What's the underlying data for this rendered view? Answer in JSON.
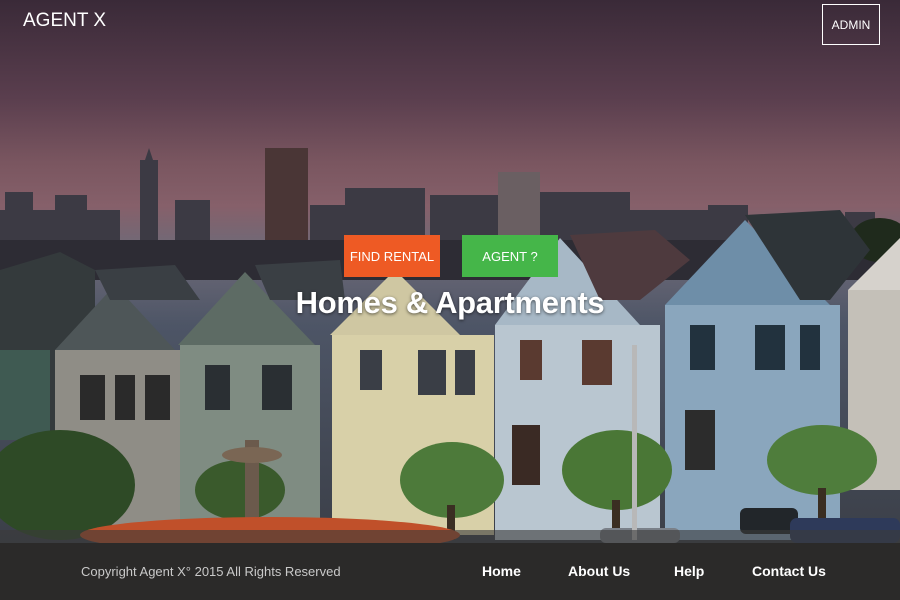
{
  "header": {
    "brand": "AGENT X",
    "admin_label": "ADMIN"
  },
  "hero": {
    "find_rental_label": "FIND RENTAL",
    "agent_label": "AGENT ?",
    "headline": "Homes & Apartments"
  },
  "footer": {
    "copyright": "Copyright Agent X° 2015 All Rights Reserved",
    "links": [
      "Home",
      "About Us",
      "Help",
      "Contact Us"
    ]
  },
  "colors": {
    "find_rental": "#ee5a24",
    "agent": "#45b649",
    "footer_bg": "#2b2a29"
  }
}
